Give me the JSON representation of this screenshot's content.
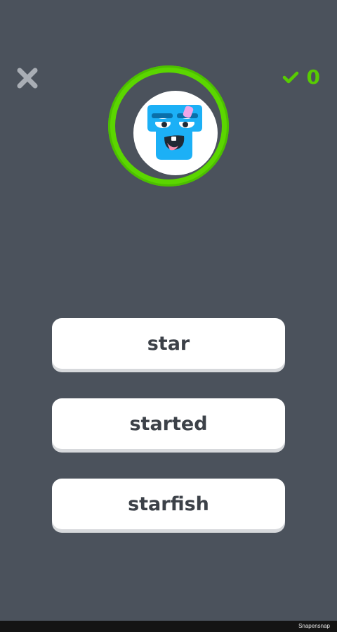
{
  "header": {
    "close_icon": "close-icon",
    "score": {
      "icon": "checkmark-icon",
      "count": "0",
      "color": "#58cc02"
    }
  },
  "character": {
    "icon": "blue-square-character-icon",
    "ring_color": "#5bd600",
    "face_color": "#1cb0f6"
  },
  "options": [
    {
      "label": "star"
    },
    {
      "label": "started"
    },
    {
      "label": "starfish"
    }
  ],
  "footer": {
    "watermark": "Snapensnap"
  }
}
